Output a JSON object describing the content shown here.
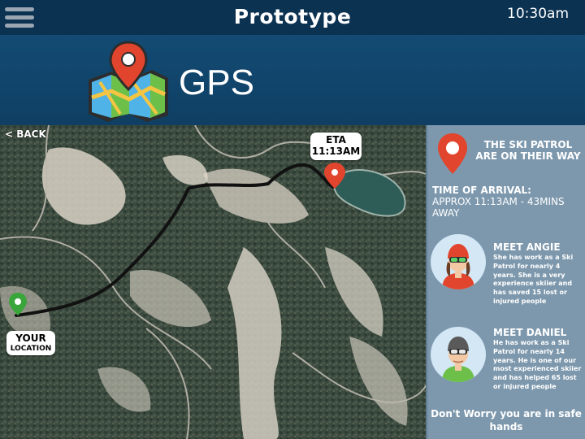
{
  "topbar": {
    "menu_icon": "hamburger-menu-icon",
    "title": "Prototype",
    "time": "10:30am"
  },
  "header": {
    "logo_icon": "gps-map-pin-icon",
    "title": "GPS"
  },
  "map": {
    "back_label": "< BACK",
    "eta_line1": "ETA",
    "eta_line2": "11:13AM",
    "your_line1": "YOUR",
    "your_line2": "LOCATION",
    "route_color": "#111111",
    "destination_pin_color": "#e2452d",
    "origin_pin_color": "#3aa53a"
  },
  "panel": {
    "pin_icon": "location-pin-icon",
    "heading": "THE SKI PATROL ARE ON THEIR WAY",
    "arrival_label": "TIME OF ARRIVAL:",
    "arrival_value": "APPROX 11:13AM - 43MINS AWAY",
    "people": [
      {
        "name": "MEET ANGIE",
        "bio": "She has work as a Ski Patrol for nearly 4 years. She is a very experience skiier and has saved 15 lost or injured people"
      },
      {
        "name": "MEET DANIEL",
        "bio": "He has work as a Ski Patrol for nearly 14 years. He is one of our most experienced skiier and has helped 65 lost or injured people"
      }
    ],
    "footer": "Don't Worry you are in safe hands"
  },
  "colors": {
    "topbar": "#0c3252",
    "header": "#134b74",
    "panel": "#7d98ad",
    "accent_red": "#e2452d"
  }
}
